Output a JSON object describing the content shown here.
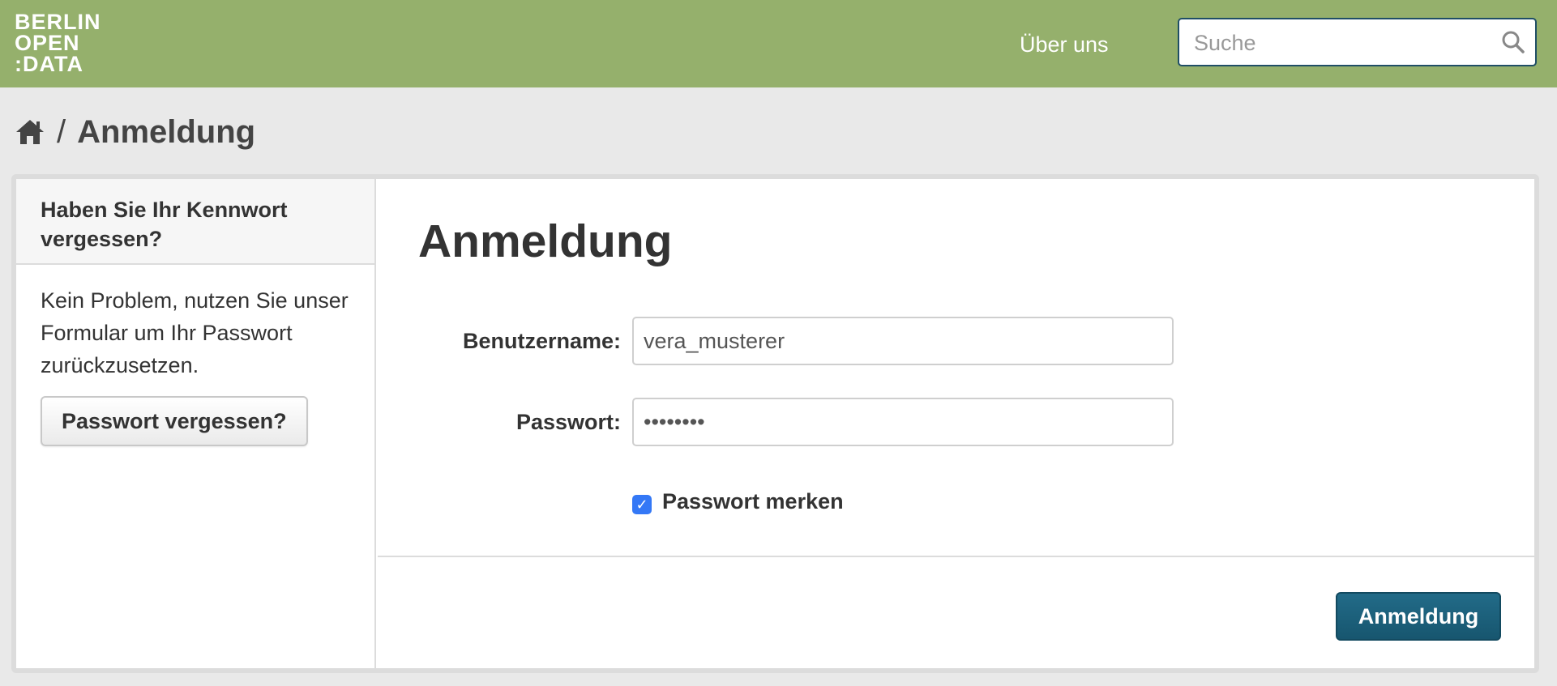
{
  "header": {
    "logo_lines": [
      "BERLIN",
      "OPEN",
      ":DATA"
    ],
    "nav_link": "Über uns",
    "search_placeholder": "Suche"
  },
  "breadcrumb": {
    "separator": "/",
    "current": "Anmeldung"
  },
  "sidebar": {
    "title": "Haben Sie Ihr Kennwort vergessen?",
    "text": "Kein Problem, nutzen Sie unser Formular um Ihr Passwort zurückzusetzen.",
    "button_label": "Passwort vergessen?"
  },
  "form": {
    "title": "Anmeldung",
    "username_label": "Benutzername:",
    "username_value": "vera_musterer",
    "password_label": "Passwort:",
    "password_value": "••••••••",
    "remember_label": "Passwort merken",
    "remember_checked": true,
    "submit_label": "Anmeldung"
  },
  "colors": {
    "header_bg": "#95b06c",
    "primary_button": "#17566f",
    "checkbox": "#3478f6"
  },
  "icons": {
    "search": "search-icon",
    "home": "home-icon",
    "check": "check-icon"
  }
}
